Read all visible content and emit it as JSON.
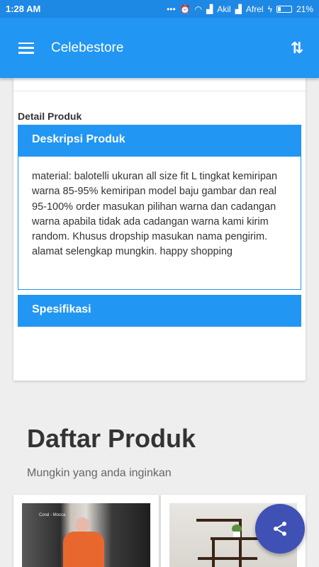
{
  "status_bar": {
    "time": "1:28 AM",
    "indicators": "... ⏰ ",
    "carrier1": "Akil",
    "carrier2": "Afrel",
    "battery": "21%"
  },
  "app_bar": {
    "title": "Celebestore",
    "menu_icon": "hamburger-menu-icon",
    "sort_icon": "sort-arrows-icon"
  },
  "detail": {
    "section_label": "Detail Produk",
    "description_header": "Deskripsi Produk",
    "description_text": "material: balotelli ukuran all size fit L tingkat kemiripan warna 85-95% kemiripan model baju gambar dan real 95-100% order masukan pilihan warna dan cadangan warna apabila tidak ada cadangan warna kami kirim random. Khusus dropship masukan nama pengirim. alamat selengkap mungkin. happy shopping",
    "specification_header": "Spesifikasi"
  },
  "product_list": {
    "title": "Daftar Produk",
    "subtitle": "Mungkin yang anda inginkan",
    "products": [
      {
        "photo_label": "Coral - Mocca"
      },
      {
        "photo_label": ""
      }
    ]
  },
  "fab": {
    "icon": "share-icon"
  },
  "colors": {
    "primary": "#2196f3",
    "status_bar": "#1e88e5",
    "fab": "#3f51b5",
    "background": "#eeeeee"
  }
}
